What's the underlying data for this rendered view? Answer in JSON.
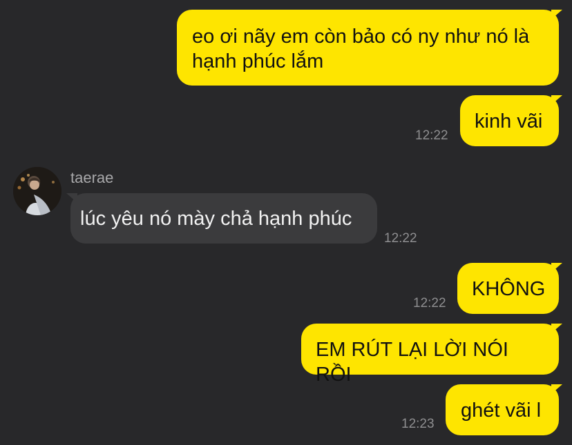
{
  "messages": [
    {
      "side": "out",
      "text": "eo ơi nãy em còn bảo có ny như nó là hạnh phúc lắm"
    },
    {
      "side": "out",
      "text": "kinh vãi",
      "time": "12:22"
    },
    {
      "side": "in",
      "sender": "taerae",
      "text": "lúc yêu nó mày chả hạnh phúc",
      "time": "12:22"
    },
    {
      "side": "out",
      "text": "KHÔNG",
      "time": "12:22"
    },
    {
      "side": "out",
      "text": "EM RÚT LẠI LỜI NÓI RỒI"
    },
    {
      "side": "out",
      "text": "ghét vãi l",
      "time": "12:23"
    }
  ],
  "colors": {
    "background": "#28282a",
    "outgoing_bubble": "#fee500",
    "incoming_bubble": "#3b3b3d"
  },
  "icons": {
    "avatar": "profile-photo"
  }
}
